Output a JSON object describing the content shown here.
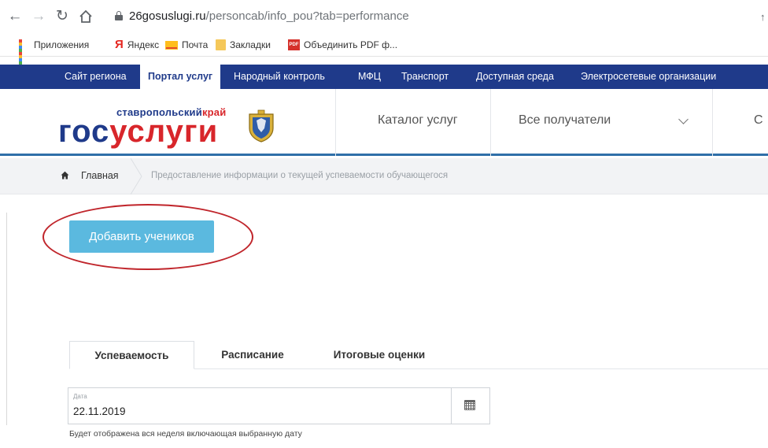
{
  "browser": {
    "url_host": "26gosuslugi.ru",
    "url_path": "/personcab/info_pou?tab=performance",
    "bookmarks": [
      {
        "label": "Приложения",
        "icon": "apps-grid-icon"
      },
      {
        "label": "Яндекс",
        "icon": "yandex-icon"
      },
      {
        "label": "Почта",
        "icon": "mail-icon"
      },
      {
        "label": "Закладки",
        "icon": "folder-icon"
      },
      {
        "label": "Объединить PDF ф...",
        "icon": "pdf-icon"
      }
    ]
  },
  "region_nav": {
    "items": [
      "Сайт региона",
      "Портал услуг",
      "Народный контроль",
      "МФЦ",
      "Транспорт",
      "Доступная среда",
      "Электросетевые организации"
    ],
    "active_index": 1
  },
  "header": {
    "logo_region_prefix": "ставропольский",
    "logo_region_suffix": "край",
    "logo_main_a": "гос",
    "logo_main_b": "услуги",
    "catalog": "Каталог услуг",
    "recipients": "Все получатели",
    "cut_item": "С"
  },
  "breadcrumb": {
    "home": "Главная",
    "current": "Предоставление информации о текущей успеваемости обучающегося"
  },
  "main": {
    "add_button": "Добавить учеников",
    "tabs": [
      "Успеваемость",
      "Расписание",
      "Итоговые оценки"
    ],
    "active_tab": 0,
    "date_label": "Дата",
    "date_value": "22.11.2019",
    "date_hint": "Будет отображена вся неделя включающая выбранную дату"
  },
  "colors": {
    "region_bar": "#1f3a8a",
    "logo_blue": "#1f3a8a",
    "logo_red": "#d8262b",
    "button": "#5bb9df",
    "annotation_ring": "#c0252b"
  }
}
